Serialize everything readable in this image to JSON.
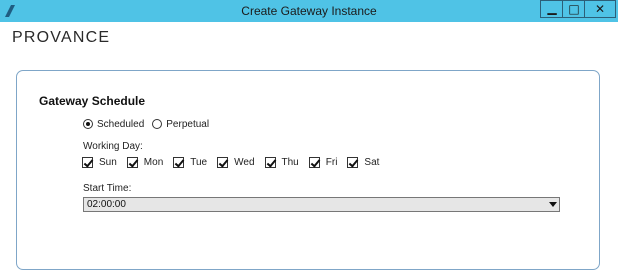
{
  "window": {
    "title": "Create Gateway Instance"
  },
  "brand": {
    "text": "PROVANCE"
  },
  "section": {
    "title": "Gateway Schedule"
  },
  "schedule_mode": {
    "options": [
      {
        "label": "Scheduled",
        "selected": true
      },
      {
        "label": "Perpetual",
        "selected": false
      }
    ]
  },
  "working_day": {
    "label": "Working Day:",
    "days": [
      {
        "label": "Sun",
        "checked": true
      },
      {
        "label": "Mon",
        "checked": true
      },
      {
        "label": "Tue",
        "checked": true
      },
      {
        "label": "Wed",
        "checked": true
      },
      {
        "label": "Thu",
        "checked": true
      },
      {
        "label": "Fri",
        "checked": true
      },
      {
        "label": "Sat",
        "checked": true
      }
    ]
  },
  "start_time": {
    "label": "Start Time:",
    "value": "02:00:00"
  },
  "icons": {
    "window_minimize": "minimize-icon",
    "window_maximize": "maximize-icon",
    "window_close": "close-icon",
    "dropdown_arrow": "chevron-down-icon"
  },
  "colors": {
    "titlebar": "#4fc3e6",
    "panel_border": "#7fa6c8",
    "dropdown_bg": "#e6e6e6"
  }
}
